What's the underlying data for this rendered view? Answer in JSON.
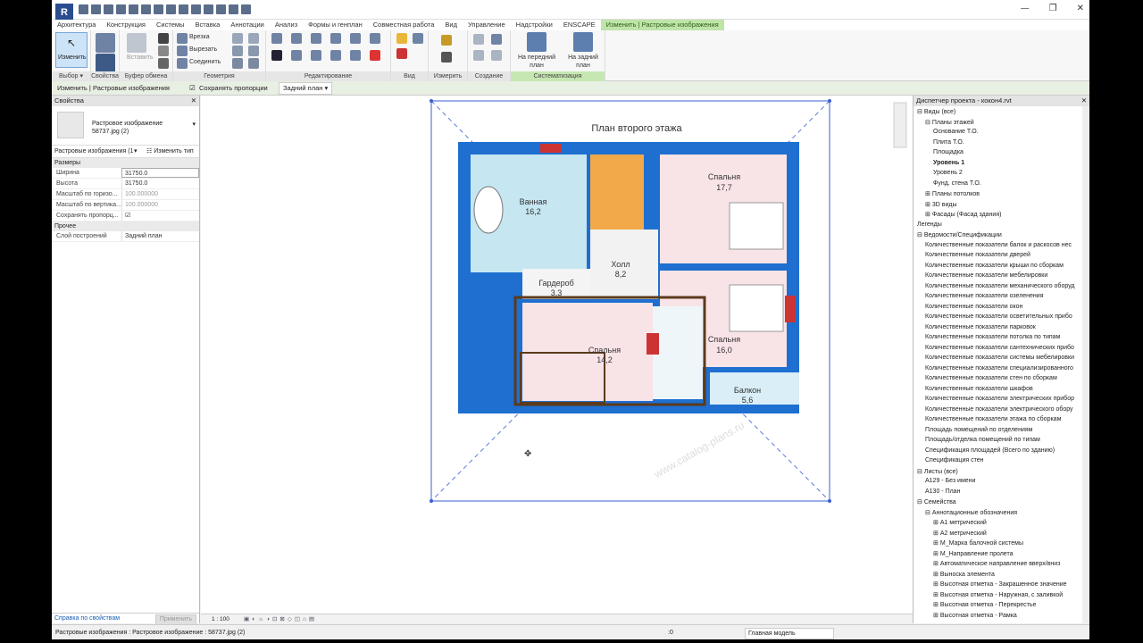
{
  "app": {
    "logo": "R",
    "window_controls": [
      "—",
      "❐",
      "✕"
    ]
  },
  "tabs": [
    "Архитектура",
    "Конструкция",
    "Системы",
    "Вставка",
    "Аннотации",
    "Анализ",
    "Формы и генплан",
    "Совместная работа",
    "Вид",
    "Управление",
    "Надстройки",
    "ENSCAPE",
    "Изменить | Растровые изображения"
  ],
  "ribbon": {
    "groups": [
      "Выбор ▾",
      "Свойства",
      "Буфер обмена",
      "Геометрия",
      "Редактирование",
      "Вид",
      "Измерить",
      "Создание",
      "Систематизация"
    ],
    "modify_label": "Изменить",
    "paste_label": "Вставить",
    "geom": {
      "cut": "Врезка",
      "cutout": "Вырезать",
      "join": "Соединить"
    },
    "arrange": {
      "front": "На передний план",
      "back": "На задний план"
    }
  },
  "context_bar": {
    "title": "Изменить | Растровые изображения",
    "checkbox_label": "Сохранять пропорции",
    "checked": true,
    "dropdown": "Задний план"
  },
  "properties": {
    "title": "Свойства",
    "close": "✕",
    "type_name": "Растровое изображение",
    "type_file": "58737.jpg (2)",
    "selector": "Растровые изображения (1",
    "edit_type": "Изменить тип",
    "sections": [
      {
        "name": "Размеры",
        "rows": [
          {
            "k": "Ширина",
            "v": "31750.0"
          },
          {
            "k": "Высота",
            "v": "31750.0"
          },
          {
            "k": "Масштаб по горизо...",
            "v": "100.000000"
          },
          {
            "k": "Масштаб по вертика...",
            "v": "100.000000"
          },
          {
            "k": "Сохранять пропорц...",
            "v": "☑"
          }
        ]
      },
      {
        "name": "Прочее",
        "rows": [
          {
            "k": "Слой построений",
            "v": "Задний план"
          }
        ]
      }
    ],
    "help_link": "Справка по свойствам",
    "apply": "Применить"
  },
  "plan": {
    "title": "План второго этажа",
    "rooms": [
      {
        "name": "Ванная",
        "area": "16,2"
      },
      {
        "name": "Спальня",
        "area": "17,7"
      },
      {
        "name": "Холл",
        "area": "8,2"
      },
      {
        "name": "Гардероб",
        "area": "3,3"
      },
      {
        "name": "Спальня",
        "area": "16,0"
      },
      {
        "name": "Спальня",
        "area": "14,2"
      },
      {
        "name": "Балкон",
        "area": "5,6"
      }
    ],
    "watermark": "www.catalog-plans.ru"
  },
  "view_status": {
    "scale": "1 : 100"
  },
  "browser": {
    "title": "Диспетчер проекта - кокон4.rvt",
    "close": "✕",
    "items": [
      {
        "t": "Виды (все)",
        "lvl": 0,
        "exp": "⊟"
      },
      {
        "t": "Планы этажей",
        "lvl": 1,
        "exp": "⊟"
      },
      {
        "t": "Основание Т.О.",
        "lvl": 2
      },
      {
        "t": "Плита Т.О.",
        "lvl": 2
      },
      {
        "t": "Площадка",
        "lvl": 2
      },
      {
        "t": "Уровень 1",
        "lvl": 2,
        "bold": true
      },
      {
        "t": "Уровень 2",
        "lvl": 2
      },
      {
        "t": "Фунд. стена Т.О.",
        "lvl": 2
      },
      {
        "t": "Планы потолков",
        "lvl": 1,
        "exp": "⊞"
      },
      {
        "t": "3D виды",
        "lvl": 1,
        "exp": "⊞"
      },
      {
        "t": "Фасады (Фасад здания)",
        "lvl": 1,
        "exp": "⊞"
      },
      {
        "t": "Легенды",
        "lvl": 0
      },
      {
        "t": "Ведомости/Спецификации",
        "lvl": 0,
        "exp": "⊟"
      },
      {
        "t": "Количественные показатели балок и раскосов нес",
        "lvl": 1
      },
      {
        "t": "Количественные показатели дверей",
        "lvl": 1
      },
      {
        "t": "Количественные показатели крыши по сборкам",
        "lvl": 1
      },
      {
        "t": "Количественные показатели мебелировки",
        "lvl": 1
      },
      {
        "t": "Количественные показатели механического оборуд",
        "lvl": 1
      },
      {
        "t": "Количественные показатели озеленения",
        "lvl": 1
      },
      {
        "t": "Количественные показатели окон",
        "lvl": 1
      },
      {
        "t": "Количественные показатели осветительных прибо",
        "lvl": 1
      },
      {
        "t": "Количественные показатели парковок",
        "lvl": 1
      },
      {
        "t": "Количественные показатели потолка по типам",
        "lvl": 1
      },
      {
        "t": "Количественные показатели сантехнических прибо",
        "lvl": 1
      },
      {
        "t": "Количественные показатели системы мебелировки",
        "lvl": 1
      },
      {
        "t": "Количественные показатели специализированного",
        "lvl": 1
      },
      {
        "t": "Количественные показатели стен по сборкам",
        "lvl": 1
      },
      {
        "t": "Количественные показатели шкафов",
        "lvl": 1
      },
      {
        "t": "Количественные показатели электрических прибор",
        "lvl": 1
      },
      {
        "t": "Количественные показатели электрического обору",
        "lvl": 1
      },
      {
        "t": "Количественные показатели этажа по сборкам",
        "lvl": 1
      },
      {
        "t": "Площадь помещений по отделениям",
        "lvl": 1
      },
      {
        "t": "Площадь/отделка помещений по типам",
        "lvl": 1
      },
      {
        "t": "Спецификация площадей (Всего по зданию)",
        "lvl": 1
      },
      {
        "t": "Спецификация стен",
        "lvl": 1
      },
      {
        "t": "Листы (все)",
        "lvl": 0,
        "exp": "⊟"
      },
      {
        "t": "А129 - Без имени",
        "lvl": 1
      },
      {
        "t": "А130 - План",
        "lvl": 1
      },
      {
        "t": "Семейства",
        "lvl": 0,
        "exp": "⊟"
      },
      {
        "t": "Аннотационные обозначения",
        "lvl": 1,
        "exp": "⊟"
      },
      {
        "t": "А1 метрический",
        "lvl": 2,
        "exp": "⊞"
      },
      {
        "t": "А2 метрический",
        "lvl": 2,
        "exp": "⊞"
      },
      {
        "t": "М_Марка балочной системы",
        "lvl": 2,
        "exp": "⊞"
      },
      {
        "t": "М_Направление пролета",
        "lvl": 2,
        "exp": "⊞"
      },
      {
        "t": "Автоматическое направление вверх/вниз",
        "lvl": 2,
        "exp": "⊞"
      },
      {
        "t": "Выноска элемента",
        "lvl": 2,
        "exp": "⊞"
      },
      {
        "t": "Высотная отметка - Закрашенное значение",
        "lvl": 2,
        "exp": "⊞"
      },
      {
        "t": "Высотная отметка - Наружная, с заливкой",
        "lvl": 2,
        "exp": "⊞"
      },
      {
        "t": "Высотная отметка - Перекрестье",
        "lvl": 2,
        "exp": "⊞"
      },
      {
        "t": "Высотная отметка - Рамка",
        "lvl": 2,
        "exp": "⊞"
      }
    ]
  },
  "statusbar": {
    "text": "Растровые изображения : Растровое изображение : 58737.jpg (2)",
    "zero": ":0",
    "model": "Главная модель"
  }
}
